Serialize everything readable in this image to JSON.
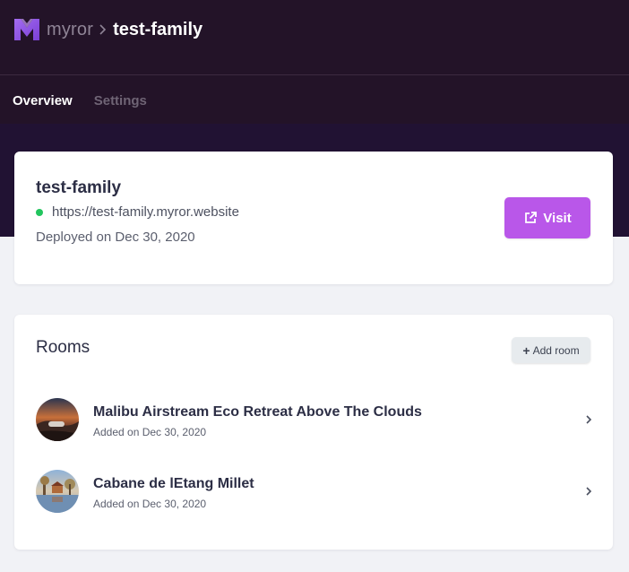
{
  "header": {
    "breadcrumb_root": "myror",
    "breadcrumb_current": "test-family"
  },
  "tabs": [
    {
      "label": "Overview",
      "active": true
    },
    {
      "label": "Settings",
      "active": false
    }
  ],
  "site": {
    "name": "test-family",
    "url": "https://test-family.myror.website",
    "status_color": "#22c55e",
    "deployed": "Deployed on Dec 30, 2020",
    "visit_label": "Visit"
  },
  "rooms": {
    "title": "Rooms",
    "add_label": "Add room",
    "items": [
      {
        "name": "Malibu Airstream Eco Retreat Above The Clouds",
        "added": "Added on Dec 30, 2020"
      },
      {
        "name": "Cabane de lEtang Millet",
        "added": "Added on Dec 30, 2020"
      }
    ]
  },
  "colors": {
    "header_bg": "#231328",
    "accent": "#b957e9",
    "page_bg": "#f1f2f6"
  },
  "icons": {
    "logo": "myror-logo",
    "breadcrumb_separator": "chevron-right-icon",
    "visit": "external-link-icon",
    "add_room": "plus-icon",
    "row": "chevron-right-icon"
  }
}
